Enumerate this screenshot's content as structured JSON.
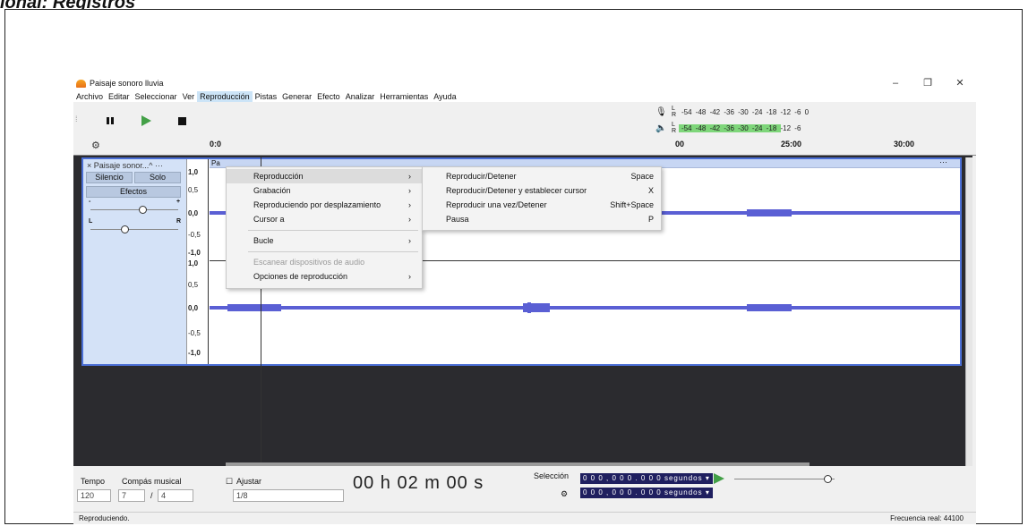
{
  "heading": "ional: Registros",
  "window": {
    "title": "Paisaje sonoro lluvia",
    "controls": [
      "–",
      "❐",
      "✕"
    ]
  },
  "menubar": [
    "Archivo",
    "Editar",
    "Seleccionar",
    "Ver",
    "Reproducción",
    "Pistas",
    "Generar",
    "Efecto",
    "Analizar",
    "Herramientas",
    "Ayuda"
  ],
  "playback_menu": {
    "items": [
      {
        "label": "Reproducción",
        "arrow": "›"
      },
      {
        "label": "Grabación",
        "arrow": "›"
      },
      {
        "label": "Reproduciendo por desplazamiento",
        "arrow": "›"
      },
      {
        "label": "Cursor a",
        "arrow": "›"
      },
      {
        "label": "Bucle",
        "arrow": "›"
      },
      {
        "label": "Escanear dispositivos de audio",
        "arrow": ""
      },
      {
        "label": "Opciones de reproducción",
        "arrow": "›"
      }
    ]
  },
  "playback_submenu": {
    "items": [
      {
        "label": "Reproducir/Detener",
        "shortcut": "Space"
      },
      {
        "label": "Reproducir/Detener y establecer cursor",
        "shortcut": "X"
      },
      {
        "label": "Reproducir una vez/Detener",
        "shortcut": "Shift+Space"
      },
      {
        "label": "Pausa",
        "shortcut": "P"
      }
    ]
  },
  "meters": {
    "record_scale": "-54 -48 -42 -36 -30 -24 -18 -12 -6 0",
    "play_scale": "-54 -48 -42 -36 -30 -24 -18 -12 -6",
    "lr": "L R",
    "play_level": 0.82
  },
  "ruler": {
    "labels": [
      "0:0",
      "00",
      "25:00",
      "30:00"
    ]
  },
  "track": {
    "name": "× Paisaje sonor...^ ···",
    "mute": "Silencio",
    "solo": "Solo",
    "effects": "Efectos",
    "gain_minus": "-",
    "gain_plus": "+",
    "pan_l": "L",
    "pan_r": "R",
    "clip_name": "Pa",
    "clip_menu": "···",
    "scale": [
      "1,0",
      "0,5",
      "0,0",
      "-0,5",
      "-1,0"
    ]
  },
  "bottom": {
    "tempo_label": "Tempo",
    "tempo_value": "120",
    "time_sig_label": "Compás musical",
    "time_sig_num": "7",
    "time_sig_sep": "/",
    "time_sig_den": "4",
    "snap_label": "Ajustar",
    "snap_value": "1/8",
    "time_display": "00 h 02 m 00 s",
    "selection_label": "Selección",
    "selection_start": "0 0 0 , 0 0 0 . 0 0 0 segundos ▾",
    "selection_end": "0 0 0 , 0 0 0 . 0 0 0 segundos ▾"
  },
  "status": {
    "left": "Reproduciendo.",
    "right": "Frecuencia real: 44100"
  },
  "colors": {
    "waveform": "#5a5fd4",
    "track_selected": "#4b6fd6",
    "play_green": "#43a047"
  }
}
